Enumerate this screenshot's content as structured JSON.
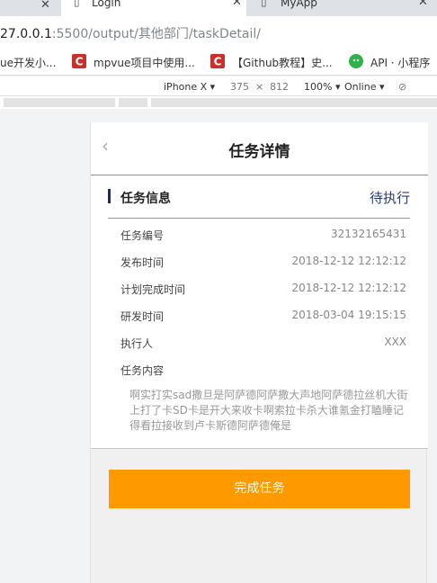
{
  "browser": {
    "tabs": [
      {
        "label": "Login",
        "active": true
      },
      {
        "label": "MyApp",
        "active": false
      }
    ],
    "url_host": "27.0.0.1",
    "url_rest": ":5500/output/其他部门/taskDetail/",
    "bookmarks": [
      {
        "label": "ue开发小..."
      },
      {
        "label": "mpvue项目中使用..."
      },
      {
        "label": "【Github教程】史..."
      },
      {
        "label": "API · 小程序"
      }
    ],
    "device_toolbar": {
      "device": "iPhone X",
      "width": "375",
      "times": "×",
      "height": "812",
      "zoom": "100%",
      "network": "Online"
    }
  },
  "page": {
    "title": "任务详情",
    "back_glyph": "‹",
    "section_title": "任务信息",
    "status": "待执行",
    "rows": [
      {
        "label": "任务编号",
        "value": "32132165431"
      },
      {
        "label": "发布时间",
        "value": "2018-12-12 12:12:12"
      },
      {
        "label": "计划完成时间",
        "value": "2018-12-12 12:12:12"
      },
      {
        "label": "研发时间",
        "value": "2018-03-04 19:15:15"
      },
      {
        "label": "执行人",
        "value": "XXX"
      },
      {
        "label": "任务内容",
        "value": ""
      }
    ],
    "content": "啊实打实sad撒旦是阿萨德阿萨撒大声地阿萨德拉丝机大街上打了卡SD卡是开大来收卡啊索拉卡杀大谁氪金打瞌睡记得看拉接收到卢卡斯德阿萨德俺是",
    "complete_button": "完成任务"
  },
  "colors": {
    "button": "#ff9900",
    "status": "#2a3a7a",
    "section_bar": "#1f2b5a"
  }
}
